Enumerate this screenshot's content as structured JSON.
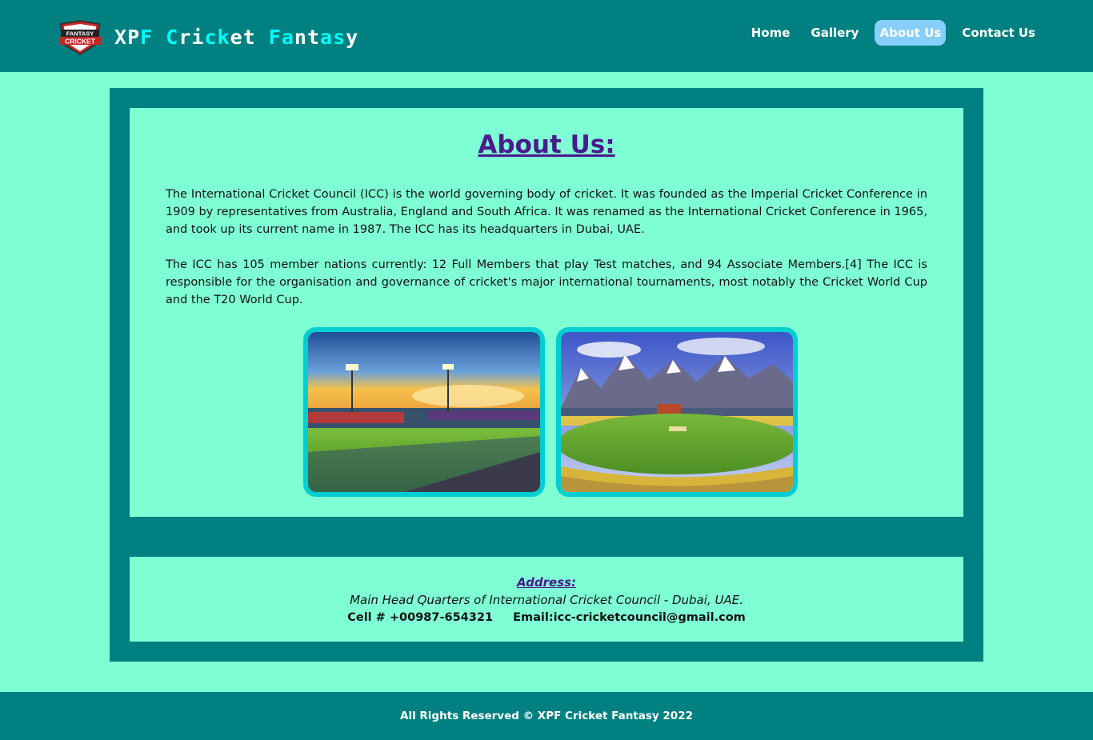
{
  "header": {
    "logo_lines": [
      "FANTASY",
      "CRICKET"
    ],
    "brand": "XPF Cricket Fantasy",
    "nav": [
      {
        "label": "Home",
        "active": false
      },
      {
        "label": "Gallery",
        "active": false
      },
      {
        "label": "About Us",
        "active": true
      },
      {
        "label": "Contact Us",
        "active": false
      }
    ]
  },
  "about": {
    "title": "About Us:",
    "paragraphs": [
      "The International Cricket Council (ICC) is the world governing body of cricket. It was founded as the Imperial Cricket Conference in 1909 by representatives from Australia, England and South Africa. It was renamed as the International Cricket Conference in 1965, and took up its current name in 1987. The ICC has its headquarters in Dubai, UAE.",
      "The ICC has 105 member nations currently: 12 Full Members that play Test matches, and 94 Associate Members.[4] The ICC is responsible for the organisation and governance of cricket's major international tournaments, most notably the Cricket World Cup and the T20 World Cup."
    ]
  },
  "address": {
    "label": "Address:",
    "text": "Main Head Quarters of International Cricket Council - Dubai, UAE.",
    "cell": "Cell # +00987-654321",
    "email": "Email:icc-cricketcouncil@gmail.com"
  },
  "footer": {
    "text": "All Rights Reserved © XPF Cricket Fantasy 2022"
  },
  "colors": {
    "page_bg": "#7fffd4",
    "header_bg": "#008080",
    "title": "#4b1a8c",
    "active_nav": "#87cefa",
    "photo_border": "#00ced1"
  }
}
